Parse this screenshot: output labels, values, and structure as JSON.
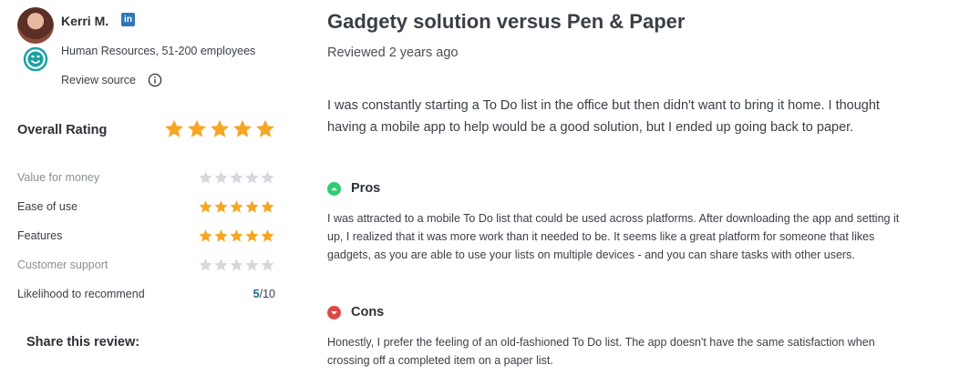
{
  "reviewer": {
    "name": "Kerri M.",
    "linkedin_label": "in",
    "role": "Human Resources, 51-200 employees",
    "review_source_label": "Review source"
  },
  "ratings": {
    "overall_label": "Overall Rating",
    "overall_stars": 5,
    "rows": [
      {
        "label": "Value for money",
        "stars": 0,
        "muted": true
      },
      {
        "label": "Ease of use",
        "stars": 5,
        "muted": false
      },
      {
        "label": "Features",
        "stars": 5,
        "muted": false
      },
      {
        "label": "Customer support",
        "stars": 0,
        "muted": true
      }
    ],
    "likelihood": {
      "label": "Likelihood to recommend",
      "value": "5",
      "suffix": "/10"
    }
  },
  "share": {
    "title": "Share this review:"
  },
  "review": {
    "title": "Gadgety solution versus Pen & Paper",
    "date": "Reviewed 2 years ago",
    "summary": "I was constantly starting a To Do list in the office but then didn't want to bring it home. I thought having a mobile app to help would be a good solution, but I ended up going back to paper.",
    "pros_label": "Pros",
    "pros_text": "I was attracted to a mobile To Do list that could be used across platforms. After downloading the app and setting it up, I realized that it was more work than it needed to be. It seems like a great platform for someone that likes gadgets, as you are able to use your lists on multiple devices - and you can share tasks with other users.",
    "cons_label": "Cons",
    "cons_text": "Honestly, I prefer the feeling of an old-fashioned To Do list. The app doesn't have the same satisfaction when crossing off a completed item on a paper list."
  },
  "colors": {
    "star_filled": "#f6a623",
    "star_empty": "#d5d8dc",
    "pros_green": "#2ecc71",
    "cons_red": "#e04848",
    "smiley_teal": "#17a2a2",
    "linkedin_blue": "#2f77b5"
  },
  "icons": {
    "linkedin": "linkedin-icon",
    "smiley": "smiley-icon",
    "info": "info-icon",
    "star": "star-icon",
    "pros": "chevron-up-circle-icon",
    "cons": "chevron-down-circle-icon"
  }
}
